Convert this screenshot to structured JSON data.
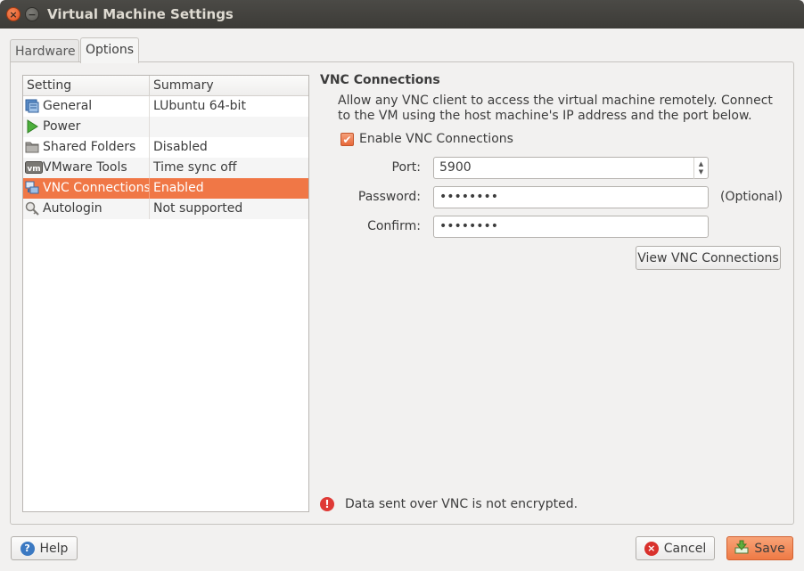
{
  "window": {
    "title": "Virtual Machine Settings",
    "close_glyph": "×",
    "minimize_glyph": "−"
  },
  "tabs": [
    {
      "label": "Hardware",
      "active": false
    },
    {
      "label": "Options",
      "active": true
    }
  ],
  "settings_list": {
    "columns": [
      "Setting",
      "Summary"
    ],
    "rows": [
      {
        "name": "General",
        "summary": "LUbuntu 64-bit",
        "icon": "general-icon",
        "selected": false
      },
      {
        "name": "Power",
        "summary": "",
        "icon": "power-icon",
        "selected": false
      },
      {
        "name": "Shared Folders",
        "summary": "Disabled",
        "icon": "folder-icon",
        "selected": false
      },
      {
        "name": "VMware Tools",
        "summary": "Time sync off",
        "icon": "vmware-tools-icon",
        "selected": false
      },
      {
        "name": "VNC Connections",
        "summary": "Enabled",
        "icon": "vnc-icon",
        "selected": true
      },
      {
        "name": "Autologin",
        "summary": "Not supported",
        "icon": "autologin-icon",
        "selected": false
      }
    ]
  },
  "vnc": {
    "title": "VNC Connections",
    "description": "Allow any VNC client to access the virtual machine remotely. Connect to the VM using the host machine's IP address and the port below.",
    "enable_label": "Enable VNC Connections",
    "enabled": true,
    "check_glyph": "✔",
    "port_label": "Port:",
    "port_value": "5900",
    "password_label": "Password:",
    "password_value": "••••••••",
    "optional_label": "(Optional)",
    "confirm_label": "Confirm:",
    "confirm_value": "••••••••",
    "view_button": "View VNC Connections",
    "warning_glyph": "!",
    "warning": "Data sent over VNC is not encrypted."
  },
  "footer": {
    "help_label": "Help",
    "help_glyph": "?",
    "cancel_label": "Cancel",
    "cancel_glyph": "×",
    "save_label": "Save"
  },
  "colors": {
    "accent": "#f07746",
    "warning": "#df3a36",
    "titlebar": "#3c3b37"
  }
}
